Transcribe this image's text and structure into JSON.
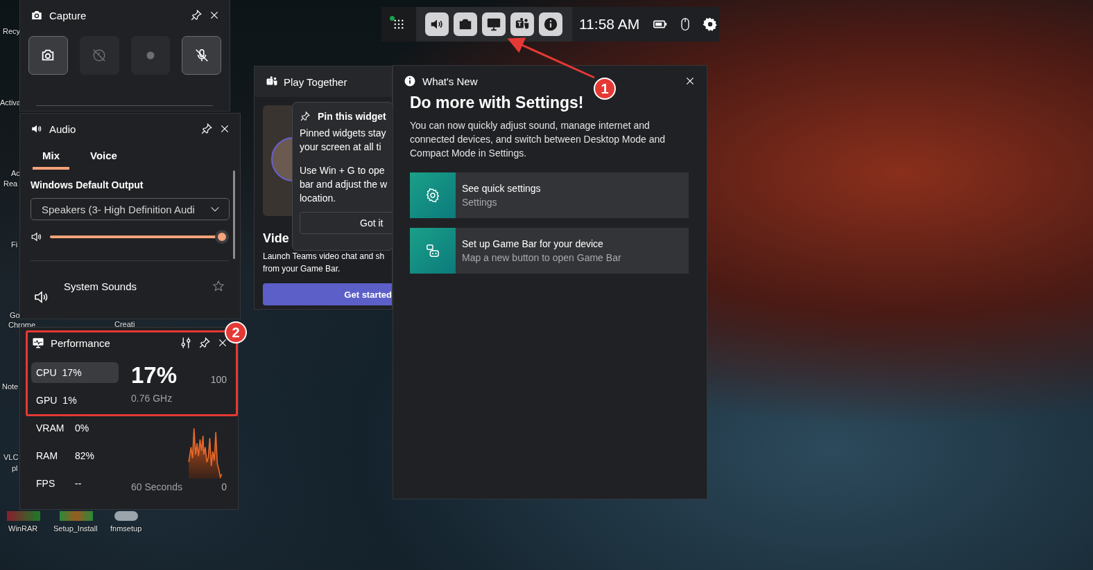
{
  "desktop": {
    "icons": [
      {
        "label": "Recy"
      },
      {
        "label": "Activa"
      },
      {
        "label": "Ac"
      },
      {
        "label": "Rea"
      },
      {
        "label": "Fi"
      },
      {
        "label": "Go"
      },
      {
        "label": "Chrome"
      },
      {
        "label": "Creati"
      },
      {
        "label": "Note"
      },
      {
        "label": "VLC"
      },
      {
        "label": "pl"
      },
      {
        "label": "WinRAR"
      },
      {
        "label": "Setup_Install"
      },
      {
        "label": "fnmsetup"
      }
    ]
  },
  "top_bar": {
    "widgets": [
      {
        "kind": "audio"
      },
      {
        "kind": "capture"
      },
      {
        "kind": "performance"
      },
      {
        "kind": "teams"
      },
      {
        "kind": "info"
      }
    ],
    "time": "11:58 AM"
  },
  "capture": {
    "title": "Capture",
    "buttons": [
      {
        "kind": "screenshot",
        "disabled": false
      },
      {
        "kind": "record_last",
        "disabled": true
      },
      {
        "kind": "record",
        "disabled": true
      },
      {
        "kind": "mic",
        "disabled": false
      }
    ]
  },
  "audio": {
    "title": "Audio",
    "tabs": [
      {
        "label": "Mix",
        "selected": true
      },
      {
        "label": "Voice",
        "selected": false
      }
    ],
    "section": "Windows Default Output",
    "device": "Speakers (3- High Definition Audi",
    "volume": {
      "level": 1.0
    },
    "apps": [
      {
        "name": "System Sounds"
      }
    ]
  },
  "performance": {
    "title": "Performance",
    "metrics": [
      {
        "label": "CPU",
        "value": "17%",
        "selected": true
      },
      {
        "label": "GPU",
        "value": "1%",
        "selected": false
      },
      {
        "label": "VRAM",
        "value": "0%",
        "selected": false
      },
      {
        "label": "RAM",
        "value": "82%",
        "selected": false
      },
      {
        "label": "FPS",
        "value": "--",
        "selected": false
      }
    ],
    "big_value": "17%",
    "frequency": "0.76 GHz",
    "axis_max": "100",
    "time_span": "60 Seconds",
    "axis_min": "0"
  },
  "play_together": {
    "title": "Play Together",
    "heading": "Vide",
    "text": "Launch Teams video chat and sh\nfrom your Game Bar.",
    "button": "Get started"
  },
  "pin_popup": {
    "title": "Pin this widget",
    "paragraphs": [
      "Pinned widgets stay\nyour screen at all ti",
      "Use Win + G to ope\nbar and adjust the w\nlocation."
    ],
    "button": "Got it"
  },
  "whats_new": {
    "title": "What's New",
    "heading": "Do more with Settings!",
    "body": "You can now quickly adjust sound, manage internet and connected devices, and switch between Desktop Mode and Compact Mode in Settings.",
    "cards": [
      {
        "kind": "settings",
        "title": "See quick settings",
        "subtitle": "Settings"
      },
      {
        "kind": "controller",
        "title": "Set up Game Bar for your device",
        "subtitle": "Map a new button to open Game Bar"
      }
    ]
  },
  "annotations": [
    {
      "label": "1"
    },
    {
      "label": "2"
    }
  ]
}
